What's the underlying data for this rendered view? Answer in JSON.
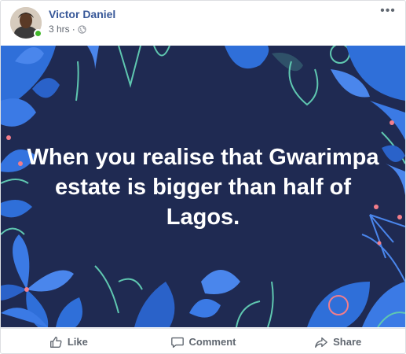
{
  "post": {
    "author": "Victor Daniel",
    "time": "3 hrs",
    "separator": "·",
    "privacy_icon": "globe-icon",
    "more_label": "•••",
    "text": "When you realise that Gwarimpa estate is bigger than half of Lagos.",
    "background_color": "#1f2a52"
  },
  "actions": {
    "like_label": "Like",
    "comment_label": "Comment",
    "share_label": "Share"
  },
  "colors": {
    "author": "#385898",
    "online": "#42b72a",
    "action_text": "#606770",
    "leaf_blue": "#2f6fd9",
    "leaf_teal": "#5fc7b0",
    "accent_pink": "#f27d8a"
  }
}
